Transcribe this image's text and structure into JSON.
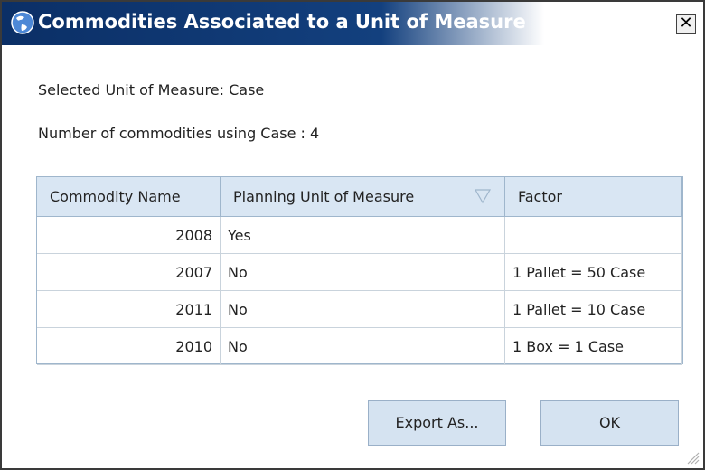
{
  "window": {
    "title": "Commodities Associated to a Unit of Measure",
    "close_glyph": "✕"
  },
  "info": {
    "selected_unit": "Selected Unit of Measure: Case",
    "count_text": "Number of commodities using Case : 4"
  },
  "table": {
    "headers": [
      "Commodity Name",
      "Planning Unit of Measure",
      "Factor"
    ],
    "rows": [
      {
        "commodity": "2008",
        "planning": "Yes",
        "factor": ""
      },
      {
        "commodity": "2007",
        "planning": "No",
        "factor": "1 Pallet = 50 Case"
      },
      {
        "commodity": "2011",
        "planning": "No",
        "factor": "1 Pallet = 10 Case"
      },
      {
        "commodity": "2010",
        "planning": "No",
        "factor": "1 Box = 1 Case"
      }
    ]
  },
  "buttons": {
    "export": "Export As...",
    "ok": "OK"
  },
  "colors": {
    "title_bar": "#0b2f66",
    "header_bg": "#d9e6f3",
    "button_bg": "#d5e3f1"
  }
}
